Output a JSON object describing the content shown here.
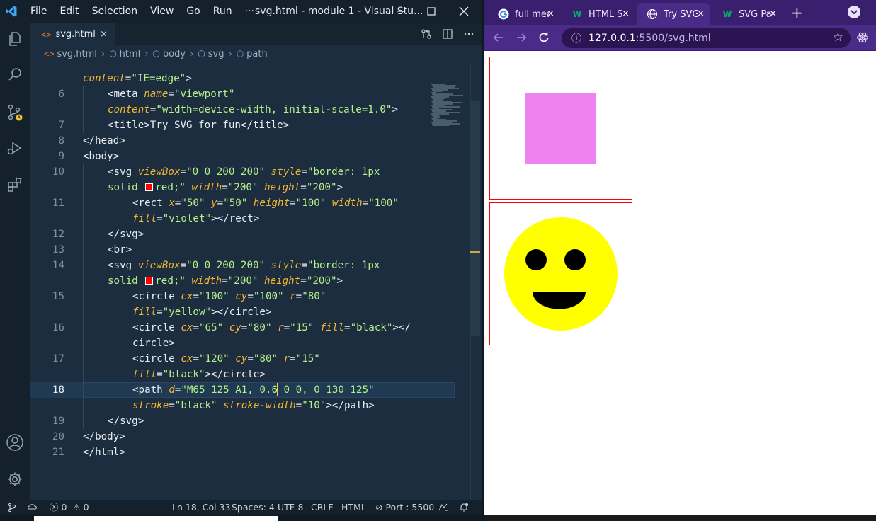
{
  "vscode": {
    "menu": [
      "File",
      "Edit",
      "Selection",
      "View",
      "Go",
      "Run",
      "···"
    ],
    "window_title": "svg.html - module 1 - Visual Stu...",
    "tab": {
      "icon": "<>",
      "label": "svg.html",
      "close": "×"
    },
    "breadcrumb": [
      "svg.html",
      "html",
      "body",
      "svg",
      "path"
    ],
    "code_lines": [
      {
        "ln": "",
        "tokens": [
          [
            "attr",
            "content"
          ],
          [
            "tag",
            "="
          ],
          [
            "str",
            "\"IE=edge\""
          ],
          [
            "tag",
            ">"
          ]
        ]
      },
      {
        "ln": "6",
        "tokens": [
          [
            "tag",
            "<meta "
          ],
          [
            "attr",
            "name"
          ],
          [
            "tag",
            "="
          ],
          [
            "str",
            "\"viewport\""
          ]
        ]
      },
      {
        "ln": "",
        "tokens": [
          [
            "attr",
            "content"
          ],
          [
            "tag",
            "="
          ],
          [
            "str",
            "\"width=device-width, initial-scale=1.0\""
          ],
          [
            "tag",
            ">"
          ]
        ]
      },
      {
        "ln": "7",
        "tokens": [
          [
            "tag",
            "<title>"
          ],
          [
            "txt",
            "Try SVG for fun"
          ],
          [
            "tag",
            "</title>"
          ]
        ]
      },
      {
        "ln": "8",
        "tokens": [
          [
            "tag",
            "</head>"
          ]
        ]
      },
      {
        "ln": "9",
        "tokens": [
          [
            "tag",
            "<body>"
          ]
        ]
      },
      {
        "ln": "10",
        "tokens": [
          [
            "tag",
            "<svg "
          ],
          [
            "attr",
            "viewBox"
          ],
          [
            "tag",
            "="
          ],
          [
            "str",
            "\"0 0 200 200\" "
          ],
          [
            "attr",
            "style"
          ],
          [
            "tag",
            "="
          ],
          [
            "str",
            "\"border: 1px"
          ]
        ]
      },
      {
        "ln": "",
        "tokens": [
          [
            "str",
            "solid "
          ],
          [
            "swatch",
            ""
          ],
          [
            "str",
            "red;\" "
          ],
          [
            "attr",
            "width"
          ],
          [
            "tag",
            "="
          ],
          [
            "str",
            "\"200\" "
          ],
          [
            "attr",
            "height"
          ],
          [
            "tag",
            "="
          ],
          [
            "str",
            "\"200\""
          ],
          [
            "tag",
            ">"
          ]
        ]
      },
      {
        "ln": "11",
        "tokens": [
          [
            "tag",
            "<rect "
          ],
          [
            "attr",
            "x"
          ],
          [
            "tag",
            "="
          ],
          [
            "str",
            "\"50\" "
          ],
          [
            "attr",
            "y"
          ],
          [
            "tag",
            "="
          ],
          [
            "str",
            "\"50\" "
          ],
          [
            "attr",
            "height"
          ],
          [
            "tag",
            "="
          ],
          [
            "str",
            "\"100\" "
          ],
          [
            "attr",
            "width"
          ],
          [
            "tag",
            "="
          ],
          [
            "str",
            "\"100\""
          ]
        ]
      },
      {
        "ln": "",
        "tokens": [
          [
            "attr",
            "fill"
          ],
          [
            "tag",
            "="
          ],
          [
            "str",
            "\"violet\""
          ],
          [
            "tag",
            "></rect>"
          ]
        ]
      },
      {
        "ln": "12",
        "tokens": [
          [
            "tag",
            "</svg>"
          ]
        ]
      },
      {
        "ln": "13",
        "tokens": [
          [
            "tag",
            "<br>"
          ]
        ]
      },
      {
        "ln": "14",
        "tokens": [
          [
            "tag",
            "<svg "
          ],
          [
            "attr",
            "viewBox"
          ],
          [
            "tag",
            "="
          ],
          [
            "str",
            "\"0 0 200 200\" "
          ],
          [
            "attr",
            "style"
          ],
          [
            "tag",
            "="
          ],
          [
            "str",
            "\"border: 1px"
          ]
        ]
      },
      {
        "ln": "",
        "tokens": [
          [
            "str",
            "solid "
          ],
          [
            "swatch",
            ""
          ],
          [
            "str",
            "red;\" "
          ],
          [
            "attr",
            "width"
          ],
          [
            "tag",
            "="
          ],
          [
            "str",
            "\"200\" "
          ],
          [
            "attr",
            "height"
          ],
          [
            "tag",
            "="
          ],
          [
            "str",
            "\"200\""
          ],
          [
            "tag",
            ">"
          ]
        ]
      },
      {
        "ln": "15",
        "tokens": [
          [
            "tag",
            "<circle "
          ],
          [
            "attr",
            "cx"
          ],
          [
            "tag",
            "="
          ],
          [
            "str",
            "\"100\" "
          ],
          [
            "attr",
            "cy"
          ],
          [
            "tag",
            "="
          ],
          [
            "str",
            "\"100\" "
          ],
          [
            "attr",
            "r"
          ],
          [
            "tag",
            "="
          ],
          [
            "str",
            "\"80\""
          ]
        ]
      },
      {
        "ln": "",
        "tokens": [
          [
            "attr",
            "fill"
          ],
          [
            "tag",
            "="
          ],
          [
            "str",
            "\"yellow\""
          ],
          [
            "tag",
            "></circle>"
          ]
        ]
      },
      {
        "ln": "16",
        "tokens": [
          [
            "tag",
            "<circle "
          ],
          [
            "attr",
            "cx"
          ],
          [
            "tag",
            "="
          ],
          [
            "str",
            "\"65\" "
          ],
          [
            "attr",
            "cy"
          ],
          [
            "tag",
            "="
          ],
          [
            "str",
            "\"80\" "
          ],
          [
            "attr",
            "r"
          ],
          [
            "tag",
            "="
          ],
          [
            "str",
            "\"15\" "
          ],
          [
            "attr",
            "fill"
          ],
          [
            "tag",
            "="
          ],
          [
            "str",
            "\"black\""
          ],
          [
            "tag",
            "></"
          ]
        ]
      },
      {
        "ln": "",
        "tokens": [
          [
            "tag",
            "circle>"
          ]
        ]
      },
      {
        "ln": "17",
        "tokens": [
          [
            "tag",
            "<circle "
          ],
          [
            "attr",
            "cx"
          ],
          [
            "tag",
            "="
          ],
          [
            "str",
            "\"120\" "
          ],
          [
            "attr",
            "cy"
          ],
          [
            "tag",
            "="
          ],
          [
            "str",
            "\"80\" "
          ],
          [
            "attr",
            "r"
          ],
          [
            "tag",
            "="
          ],
          [
            "str",
            "\"15\""
          ]
        ]
      },
      {
        "ln": "",
        "tokens": [
          [
            "attr",
            "fill"
          ],
          [
            "tag",
            "="
          ],
          [
            "str",
            "\"black\""
          ],
          [
            "tag",
            "></circle>"
          ]
        ]
      },
      {
        "ln": "18",
        "tokens": [
          [
            "tag",
            "<path "
          ],
          [
            "attr",
            "d"
          ],
          [
            "tag",
            "="
          ],
          [
            "str",
            "\"M65 125 A1, 0.6"
          ],
          [
            "caret",
            ""
          ],
          [
            "str",
            " 0 0, 0 130 125\""
          ]
        ]
      },
      {
        "ln": "",
        "tokens": [
          [
            "attr",
            "stroke"
          ],
          [
            "tag",
            "="
          ],
          [
            "str",
            "\"black\" "
          ],
          [
            "attr",
            "stroke-width"
          ],
          [
            "tag",
            "="
          ],
          [
            "str",
            "\"10\""
          ],
          [
            "tag",
            ">"
          ],
          [
            "caret",
            ""
          ],
          [
            "tag",
            "</path>"
          ]
        ]
      },
      {
        "ln": "19",
        "tokens": [
          [
            "tag",
            "</svg>"
          ]
        ]
      },
      {
        "ln": "20",
        "tokens": [
          [
            "tag",
            "</body>"
          ]
        ]
      },
      {
        "ln": "21",
        "tokens": [
          [
            "tag",
            "</html>"
          ]
        ]
      }
    ],
    "status": {
      "errors": "0",
      "warnings": "0",
      "position": "Ln 18, Col 33",
      "spaces": "Spaces: 4",
      "encoding": "UTF-8",
      "eol": "CRLF",
      "language": "HTML",
      "port": "Port : 5500"
    },
    "colors": {
      "background": "#1b2d3e",
      "string": "#b6f089",
      "attribute": "#f2b632",
      "tag": "#e8edf2"
    }
  },
  "chrome": {
    "tabs": [
      {
        "label": "full mea",
        "favicon": "google-icon"
      },
      {
        "label": "HTML S",
        "favicon": "w3schools-icon"
      },
      {
        "label": "Try SVG",
        "favicon": "globe-icon",
        "active": true
      },
      {
        "label": "SVG Pa",
        "favicon": "w3schools-icon"
      }
    ],
    "tab_close": "×",
    "new_tab": "+",
    "url_host": "127.0.0.1",
    "url_path": ":5500/svg.html",
    "theme_color": "#4a2b88"
  },
  "page": {
    "svg1": {
      "rect_fill": "violet",
      "border": "red"
    },
    "svg2": {
      "face_fill": "yellow",
      "eye_fill": "black",
      "mouth": "black",
      "border": "red"
    }
  }
}
